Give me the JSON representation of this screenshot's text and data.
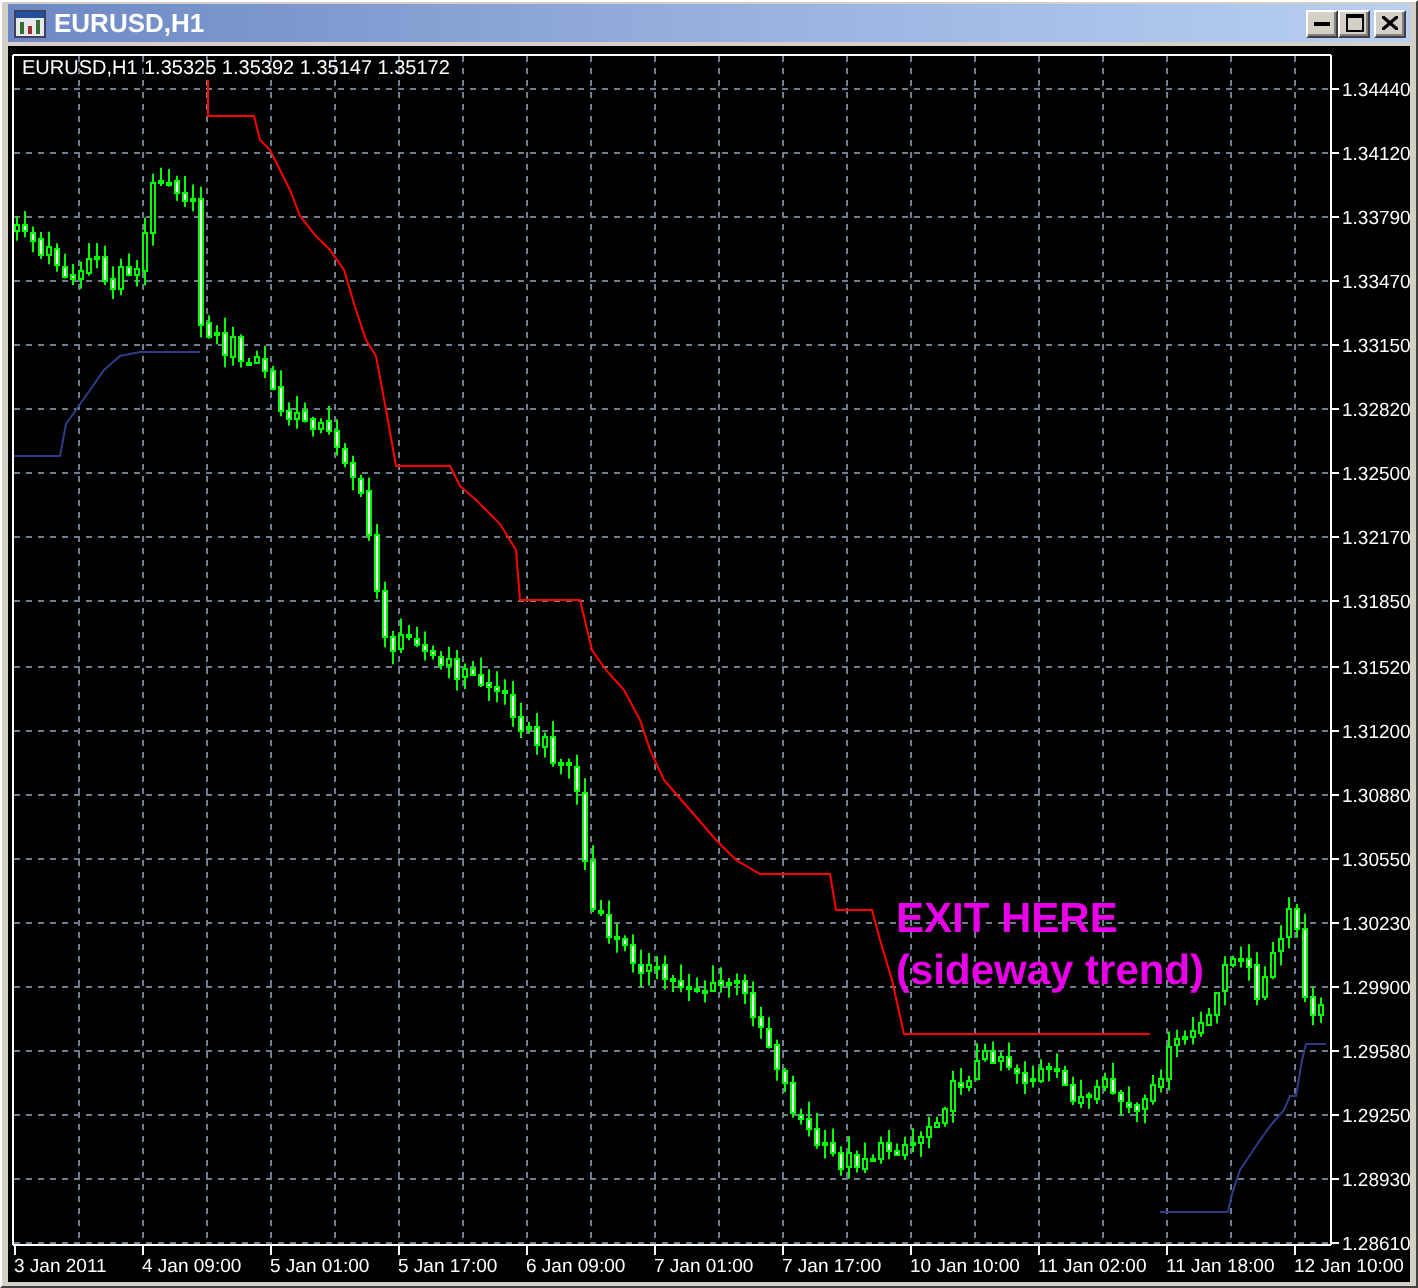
{
  "window": {
    "title": "EURUSD,H1"
  },
  "chart": {
    "header": {
      "symbol": "EURUSD,H1",
      "ohlc": "1.35325 1.35392 1.35147 1.35172"
    },
    "price_axis": {
      "labels": [
        "1.34440",
        "1.34120",
        "1.33790",
        "1.33470",
        "1.33150",
        "1.32820",
        "1.32500",
        "1.32170",
        "1.31850",
        "1.31520",
        "1.31200",
        "1.30880",
        "1.30550",
        "1.30230",
        "1.29900",
        "1.29580",
        "1.29250",
        "1.28930",
        "1.28610"
      ]
    },
    "time_axis": {
      "labels": [
        "3 Jan 2011",
        "4 Jan 09:00",
        "5 Jan 01:00",
        "5 Jan 17:00",
        "6 Jan 09:00",
        "7 Jan 01:00",
        "7 Jan 17:00",
        "10 Jan 10:00",
        "11 Jan 02:00",
        "11 Jan 18:00",
        "12 Jan 10:00"
      ]
    },
    "annotation": {
      "lines": [
        "EXIT HERE",
        "(sideway trend)"
      ]
    }
  }
}
